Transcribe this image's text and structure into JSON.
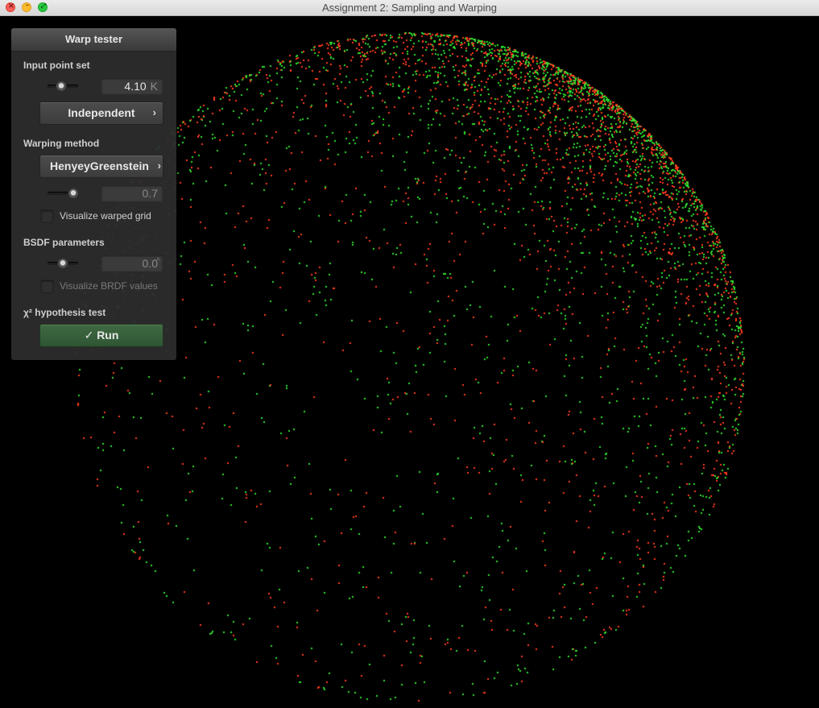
{
  "window": {
    "title": "Assignment 2: Sampling and Warping"
  },
  "panel": {
    "title": "Warp tester",
    "input_point_set": {
      "label": "Input point set",
      "count_value": "4.10",
      "count_unit": "K",
      "count_slider_fraction": 0.45,
      "point_type": "Independent"
    },
    "warping_method": {
      "label": "Warping method",
      "method": "HenyeyGreenstein",
      "parameter_value": "0.7",
      "parameter_slider_fraction": 0.85,
      "visualize_grid_label": "Visualize warped grid",
      "visualize_grid_checked": false
    },
    "bsdf_parameters": {
      "label": "BSDF parameters",
      "parameter_value": "0.0",
      "parameter_slider_fraction": 0.5,
      "visualize_brdf_label": "Visualize BRDF values",
      "visualize_brdf_checked": false
    },
    "hypothesis_test": {
      "label": "χ² hypothesis test",
      "run_label": "✓ Run"
    }
  },
  "visualization": {
    "point_colors": [
      "#ff3b1f",
      "#2fe02f"
    ],
    "background": "#000000"
  }
}
